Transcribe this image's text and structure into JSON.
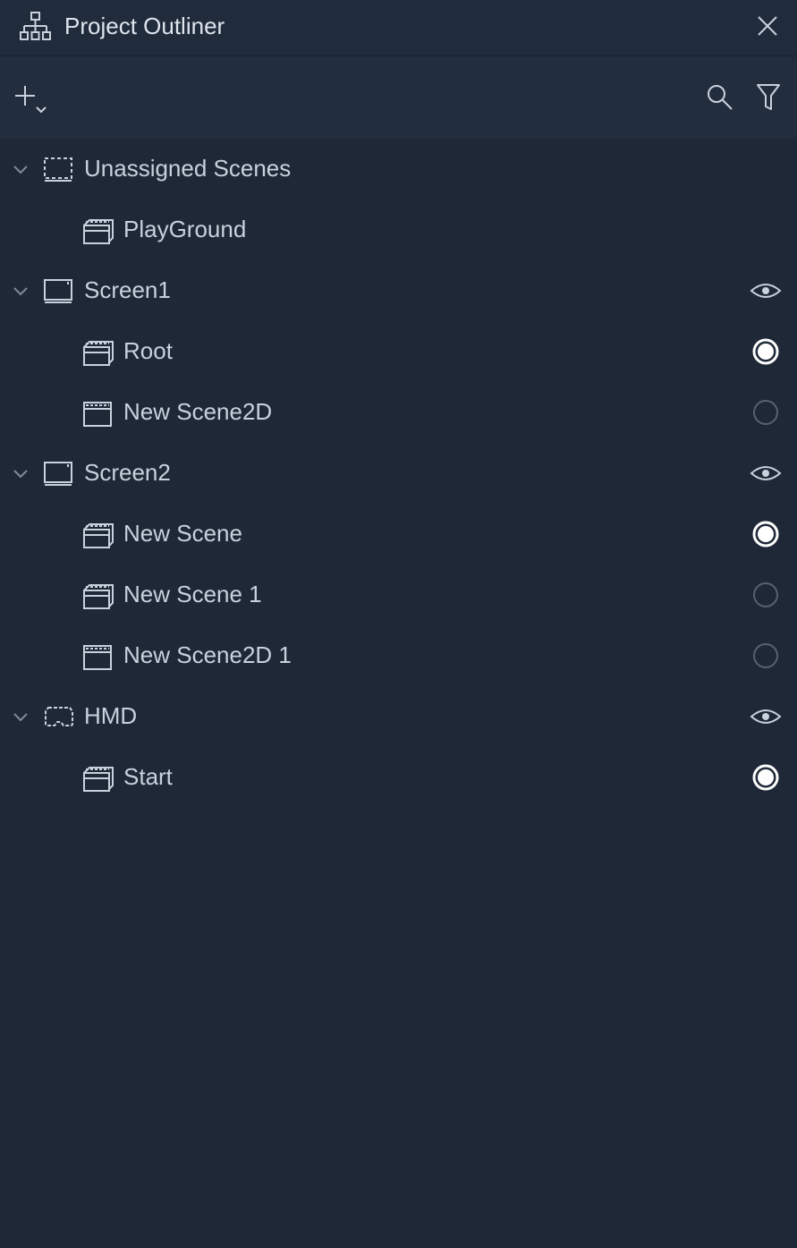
{
  "window": {
    "title": "Project Outliner",
    "title_icon": "hierarchy-icon",
    "close_icon": "close-icon"
  },
  "toolbar": {
    "add_icon": "add-dropdown-icon",
    "search_icon": "search-icon",
    "filter_icon": "filter-icon"
  },
  "tree": {
    "groups": [
      {
        "label": "Unassigned Scenes",
        "icon": "unassigned-screen-icon",
        "has_eye": false,
        "scenes": [
          {
            "label": "PlayGround",
            "icon": "scene-3d-icon",
            "radio": "none"
          }
        ]
      },
      {
        "label": "Screen1",
        "icon": "screen-icon",
        "has_eye": true,
        "scenes": [
          {
            "label": "Root",
            "icon": "scene-3d-icon",
            "radio": "selected"
          },
          {
            "label": "New Scene2D",
            "icon": "scene-2d-icon",
            "radio": "unselected"
          }
        ]
      },
      {
        "label": "Screen2",
        "icon": "screen-icon",
        "has_eye": true,
        "scenes": [
          {
            "label": "New Scene",
            "icon": "scene-3d-icon",
            "radio": "selected"
          },
          {
            "label": "New Scene 1",
            "icon": "scene-3d-icon",
            "radio": "unselected"
          },
          {
            "label": "New Scene2D 1",
            "icon": "scene-2d-icon",
            "radio": "unselected"
          }
        ]
      },
      {
        "label": "HMD",
        "icon": "hmd-icon",
        "has_eye": true,
        "scenes": [
          {
            "label": "Start",
            "icon": "scene-3d-icon",
            "radio": "selected"
          }
        ]
      }
    ]
  },
  "colors": {
    "background": "#1e2837",
    "titlebar": "#202b3b",
    "toolbar": "#222d3e",
    "text": "#c9d1dc",
    "icon": "#c9d1dc",
    "radio_off": "#566173"
  }
}
